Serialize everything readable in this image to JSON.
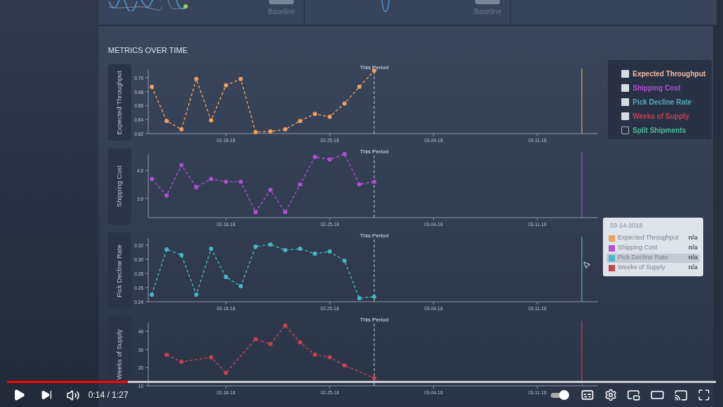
{
  "top_cards": [
    {
      "baseline_label": "Baseline"
    },
    {
      "baseline_label": "Baseline"
    }
  ],
  "section_title": "METRICS OVER TIME",
  "metrics": [
    {
      "period_label": "This Period",
      "chart_data": {
        "type": "line",
        "categories": [
          null,
          null,
          null,
          null,
          null,
          "02-18-18",
          null,
          null,
          null,
          null,
          null,
          null,
          "02-25-18",
          null,
          null,
          null,
          null,
          null,
          null,
          "03-04-18",
          null,
          null,
          null,
          null,
          null,
          null,
          "03-11-18",
          null,
          null,
          null
        ],
        "ylim": [
          0.62,
          0.711
        ],
        "yticks": [
          {
            "value": 0.62,
            "label": "0.62"
          },
          {
            "value": 0.64,
            "label": "0.64"
          },
          {
            "value": 0.66,
            "label": "0.66"
          },
          {
            "value": 0.68,
            "label": "0.68"
          },
          {
            "value": 0.7,
            "label": "0.70"
          }
        ],
        "series": [
          {
            "name": "Expected Throughput",
            "color": "#f0a05a",
            "line_style": "dashed",
            "marker": "circle",
            "values": [
              0.687,
              0.638,
              0.626,
              0.698,
              0.639,
              0.689,
              0.698,
              0.622,
              0.623,
              0.626,
              0.638,
              0.648,
              0.644,
              0.663,
              0.687,
              0.71,
              null,
              null,
              null,
              null,
              null,
              null,
              null,
              null,
              null,
              null,
              null,
              null,
              null,
              null
            ]
          }
        ]
      }
    },
    {
      "period_label": "This Period",
      "chart_data": {
        "type": "line",
        "categories": [
          null,
          null,
          null,
          null,
          null,
          "02-18-18",
          null,
          null,
          null,
          null,
          null,
          null,
          "02-25-18",
          null,
          null,
          null,
          null,
          null,
          null,
          "03-04-18",
          null,
          null,
          null,
          null,
          null,
          null,
          "03-11-18",
          null,
          null,
          null
        ],
        "ylim": [
          3.83,
          4.06
        ],
        "yticks": [
          {
            "value": 3.9,
            "label": "3.9"
          },
          {
            "value": 4,
            "label": "4.0"
          }
        ],
        "series": [
          {
            "name": "Shipping Cost",
            "color": "#b24fd2",
            "line_style": "dashed",
            "marker": "circle",
            "values": [
              3.97,
              3.91,
              4.02,
              3.94,
              3.97,
              3.96,
              3.96,
              3.85,
              3.93,
              3.85,
              3.95,
              4.05,
              4.04,
              4.06,
              3.95,
              3.96,
              null,
              null,
              null,
              null,
              null,
              null,
              null,
              null,
              null,
              null,
              null,
              null,
              null,
              null
            ]
          }
        ]
      }
    },
    {
      "period_label": "This Period",
      "chart_data": {
        "type": "line",
        "categories": [
          null,
          null,
          null,
          null,
          null,
          "02-18-18",
          null,
          null,
          null,
          null,
          null,
          null,
          "02-25-18",
          null,
          null,
          null,
          null,
          null,
          null,
          "03-04-18",
          null,
          null,
          null,
          null,
          null,
          null,
          "03-11-18",
          null,
          null,
          null
        ],
        "ylim": [
          0.24,
          0.33
        ],
        "yticks": [
          {
            "value": 0.24,
            "label": "0.24"
          },
          {
            "value": 0.26,
            "label": "0.26"
          },
          {
            "value": 0.28,
            "label": "0.28"
          },
          {
            "value": 0.3,
            "label": "0.30"
          },
          {
            "value": 0.32,
            "label": "0.32"
          }
        ],
        "series": [
          {
            "name": "Pick Decline Rate",
            "color": "#45b7c6",
            "line_style": "dashed",
            "marker": "circle",
            "values": [
              0.25,
              0.314,
              0.306,
              0.25,
              0.315,
              0.275,
              0.262,
              0.318,
              0.321,
              0.313,
              0.315,
              0.308,
              0.311,
              0.298,
              0.245,
              0.247,
              null,
              null,
              null,
              null,
              null,
              null,
              null,
              null,
              null,
              null,
              null,
              null,
              null,
              null
            ]
          }
        ]
      }
    },
    {
      "period_label": "This Period",
      "chart_data": {
        "type": "line",
        "categories": [
          null,
          null,
          null,
          null,
          null,
          "02-18-18",
          null,
          null,
          null,
          null,
          null,
          null,
          "02-25-18",
          null,
          null,
          null,
          null,
          null,
          null,
          "03-04-18",
          null,
          null,
          null,
          null,
          null,
          null,
          "03-11-18",
          null,
          null,
          null
        ],
        "ylim": [
          10,
          45
        ],
        "yticks": [
          {
            "value": 10,
            "label": "10"
          },
          {
            "value": 20,
            "label": "20"
          },
          {
            "value": 30,
            "label": "30"
          },
          {
            "value": 40,
            "label": "40"
          }
        ],
        "series": [
          {
            "name": "Weeks of Supply",
            "color": "#c8414f",
            "line_style": "dashed",
            "marker": "circle",
            "values": [
              null,
              27,
              23.2,
              null,
              25.7,
              17.1,
              null,
              35.7,
              33,
              43.2,
              33.9,
              27.1,
              25.7,
              21.2,
              null,
              14.3,
              null,
              null,
              null,
              null,
              null,
              null,
              null,
              null,
              null,
              null,
              null,
              null,
              null,
              null
            ]
          }
        ]
      }
    }
  ],
  "legend": {
    "items": [
      {
        "label": "Expected Throughput",
        "color": "#f2b8a0",
        "checked": true
      },
      {
        "label": "Shipping Cost",
        "color": "#b24fd2",
        "checked": true
      },
      {
        "label": "Pick Decline Rate",
        "color": "#55aabb",
        "checked": true
      },
      {
        "label": "Weeks of Supply",
        "color": "#c8414f",
        "checked": true
      },
      {
        "label": "Split Shipments",
        "color": "#4fb89a",
        "checked": false
      }
    ]
  },
  "tooltip": {
    "date": "03-14-2018",
    "rows": [
      {
        "label": "Expected Throughput",
        "color": "#f0a05a",
        "value": "n/a",
        "selected": false
      },
      {
        "label": "Shipping Cost",
        "color": "#b24fd2",
        "value": "n/a",
        "selected": false
      },
      {
        "label": "Pick Decline Rate",
        "color": "#45b7c6",
        "value": "n/a",
        "selected": true
      },
      {
        "label": "Weeks of Supply",
        "color": "#c8414f",
        "value": "n/a",
        "selected": false
      }
    ]
  },
  "player": {
    "progress": {
      "level": 0.17
    },
    "time": "0:14 / 1:27",
    "autoplay": {
      "on": true
    }
  }
}
